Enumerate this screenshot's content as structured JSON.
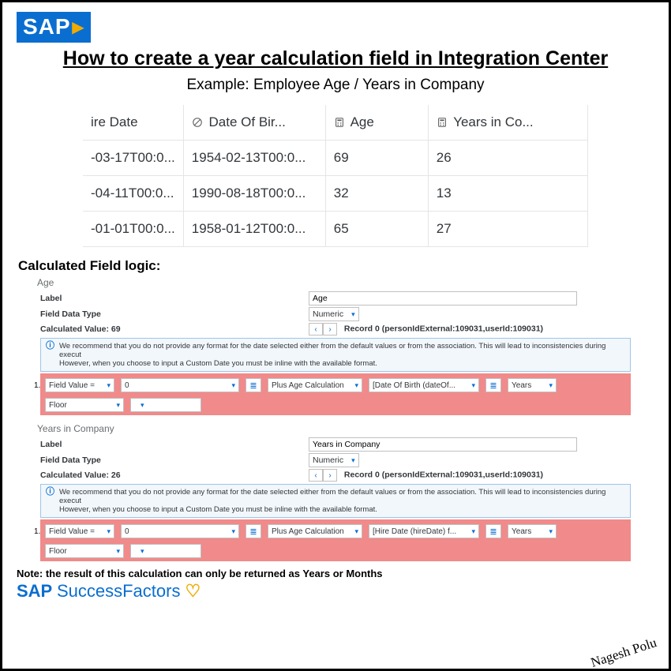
{
  "header": {
    "sap_logo_text": "SAP",
    "title": "How to create a year calculation field in Integration Center",
    "subtitle": "Example: Employee Age / Years in Company"
  },
  "table": {
    "columns": {
      "hire_date": "ire Date",
      "dob": "Date Of Bir...",
      "age": "Age",
      "yic": "Years in Co..."
    },
    "rows": [
      {
        "hire_date": "-03-17T00:0...",
        "dob": "1954-02-13T00:0...",
        "age": "69",
        "yic": "26"
      },
      {
        "hire_date": "-04-11T00:0...",
        "dob": "1990-08-18T00:0...",
        "age": "32",
        "yic": "13"
      },
      {
        "hire_date": "-01-01T00:0...",
        "dob": "1958-01-12T00:0...",
        "age": "65",
        "yic": "27"
      }
    ]
  },
  "logic_heading": "Calculated Field logic:",
  "age_block": {
    "title": "Age",
    "label_lab": "Label",
    "label_val": "Age",
    "type_lab": "Field Data Type",
    "type_val": "Numeric",
    "calc_lab": "Calculated Value: 69",
    "record": "Record 0 (personIdExternal:109031,userId:109031)",
    "info": "We recommend that you do not provide any format for the date selected either from the default values or from the association. This will lead to inconsistencies during execut\nHowever, when you choose to input a Custom Date you must be inline with the available format.",
    "chips": {
      "field_value": "Field Value =",
      "zero": "0",
      "plus_age": "Plus Age Calculation",
      "date_field": "[Date Of Birth (dateOf...",
      "years": "Years",
      "floor": "Floor"
    }
  },
  "yic_block": {
    "title": "Years in Company",
    "label_lab": "Label",
    "label_val": "Years in Company",
    "type_lab": "Field Data Type",
    "type_val": "Numeric",
    "calc_lab": "Calculated Value: 26",
    "record": "Record 0 (personIdExternal:109031,userId:109031)",
    "info": "We recommend that you do not provide any format for the date selected either from the default values or from the association. This will lead to inconsistencies during execut\nHowever, when you choose to input a Custom Date you must be inline with the available format.",
    "chips": {
      "field_value": "Field Value =",
      "zero": "0",
      "plus_age": "Plus Age Calculation",
      "date_field": "[Hire Date (hireDate) f...",
      "years": "Years",
      "floor": "Floor"
    }
  },
  "note": "Note: the result of this calculation can only be returned as Years or Months",
  "sf_logo": {
    "sap": "SAP",
    "rest": "SuccessFactors"
  },
  "signature": "Nagesh Polu"
}
